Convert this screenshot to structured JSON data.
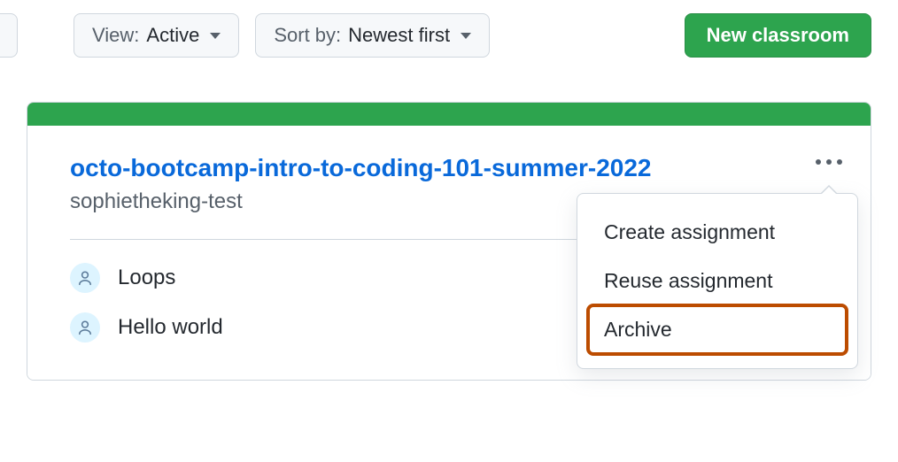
{
  "toolbar": {
    "view_label": "View:",
    "view_value": "Active",
    "sort_label": "Sort by:",
    "sort_value": "Newest first",
    "new_classroom": "New classroom"
  },
  "classroom": {
    "title": "octo-bootcamp-intro-to-coding-101-summer-2022",
    "owner": "sophietheking-test",
    "assignments": [
      {
        "name": "Loops"
      },
      {
        "name": "Hello world"
      }
    ]
  },
  "menu": {
    "items": [
      {
        "label": "Create assignment",
        "highlighted": false
      },
      {
        "label": "Reuse assignment",
        "highlighted": false
      },
      {
        "label": "Archive",
        "highlighted": true
      }
    ]
  }
}
